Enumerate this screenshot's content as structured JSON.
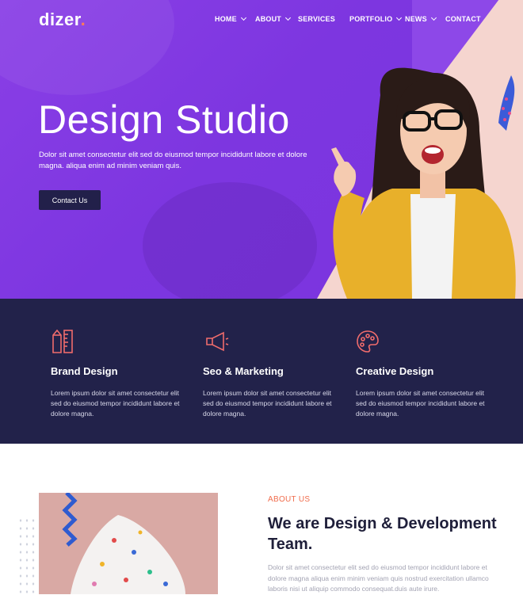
{
  "brand": {
    "logo_text": "dizer",
    "logo_dot": "."
  },
  "nav": {
    "items": [
      {
        "label": "HOME",
        "has_dropdown": true
      },
      {
        "label": "ABOUT",
        "has_dropdown": true
      },
      {
        "label": "SERVICES",
        "has_dropdown": false
      },
      {
        "label": "PORTFOLIO",
        "has_dropdown": true
      },
      {
        "label": "NEWS",
        "has_dropdown": true
      },
      {
        "label": "CONTACT",
        "has_dropdown": false
      }
    ]
  },
  "hero": {
    "title": "Design Studio",
    "text": "Dolor sit amet consectetur elit sed do eiusmod tempor incididunt labore et dolore magna. aliqua enim ad minim veniam quis.",
    "button_label": "Contact Us"
  },
  "services": [
    {
      "icon": "pencil-ruler-icon",
      "title": "Brand Design",
      "text": "Lorem ipsum dolor sit amet consectetur elit sed do eiusmod tempor incididunt labore et dolore magna."
    },
    {
      "icon": "megaphone-icon",
      "title": "Seo & Marketing",
      "text": "Lorem ipsum dolor sit amet consectetur elit sed do eiusmod tempor incididunt labore et dolore magna."
    },
    {
      "icon": "palette-icon",
      "title": "Creative Design",
      "text": "Lorem ipsum dolor sit amet consectetur elit sed do eiusmod tempor incididunt labore et dolore magna."
    }
  ],
  "about": {
    "label": "ABOUT US",
    "title": "We are Design & Development Team.",
    "text": "Dolor sit amet consectetur elit sed do eiusmod tempor incididunt labore et dolore magna aliqua enim minim veniam quis nostrud exercitation ullamco laboris nisi ut aliquip commodo consequat.duis aute irure."
  },
  "colors": {
    "hero_purple": "#7d36e0",
    "accent_peach": "#f5d5cf",
    "navy": "#22224a",
    "accent_coral": "#f06c4c"
  }
}
